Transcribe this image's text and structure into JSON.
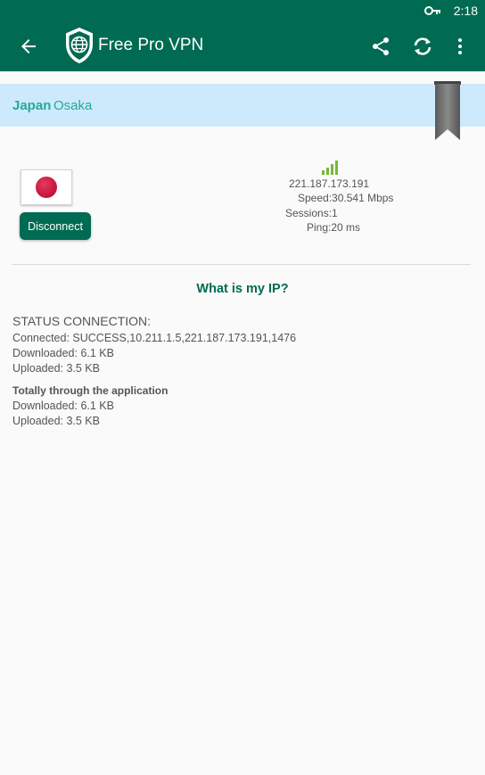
{
  "statusbar": {
    "time": "2:18",
    "vpn_key_icon": "key-icon"
  },
  "appbar": {
    "title": "Free Pro VPN",
    "icons": [
      "back-arrow-icon",
      "shield-globe-icon",
      "share-icon",
      "refresh-icon",
      "more-vert-icon"
    ]
  },
  "server": {
    "country": "Japan",
    "city": "Osaka"
  },
  "connection": {
    "disconnect_label": "Disconnect",
    "ip": "221.187.173.191",
    "speed": "Speed:30.541 Mbps",
    "sessions": "Sessions:1",
    "ping": "Ping:20 ms",
    "signal_level": 4
  },
  "what_is_my_ip": "What is my IP?",
  "status": {
    "title": "STATUS CONNECTION:",
    "connected": "Connected: SUCCESS,10.211.1.5,221.187.173.191,1476",
    "downloaded": "Downloaded: 6.1 KB",
    "uploaded": "Uploaded: 3.5 KB",
    "total_title": "Totally through the application",
    "total_downloaded": "Downloaded: 6.1 KB",
    "total_uploaded": "Uploaded: 3.5 KB"
  },
  "colors": {
    "primary": "#006b52",
    "server_bar": "#cdeafc",
    "server_text": "#23a99a",
    "signal": "#77b83a",
    "flag_red": "#bc002d"
  }
}
